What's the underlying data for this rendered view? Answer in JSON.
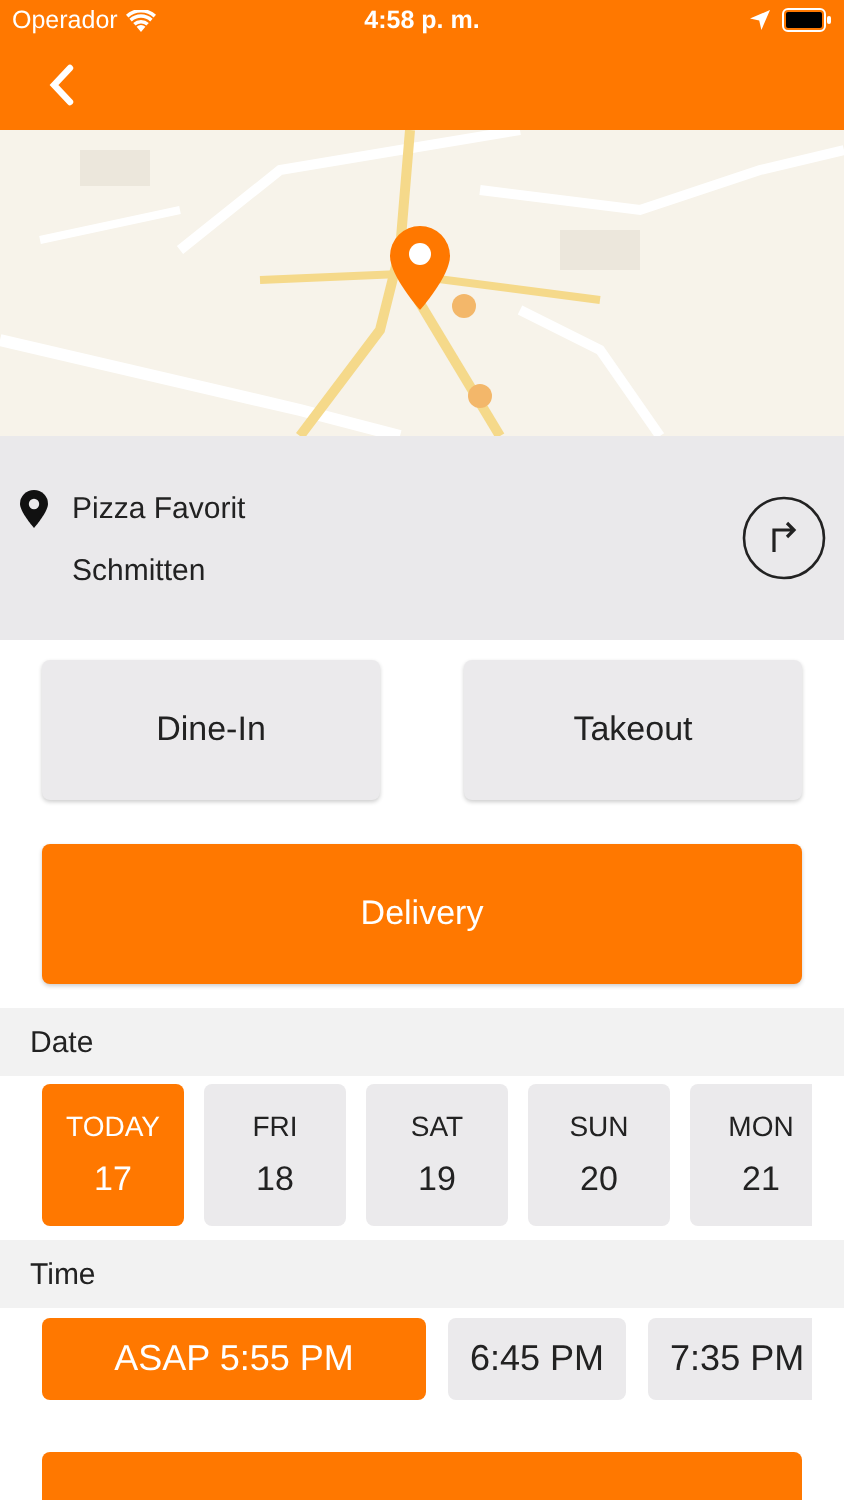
{
  "status_bar": {
    "carrier": "Operador",
    "time": "4:58 p. m."
  },
  "place": {
    "name": "Pizza Favorit",
    "city": "Schmitten"
  },
  "order_types": [
    {
      "label": "Dine-In",
      "selected": false
    },
    {
      "label": "Takeout",
      "selected": false
    },
    {
      "label": "Delivery",
      "selected": true
    }
  ],
  "date": {
    "header": "Date",
    "days": [
      {
        "weekday": "TODAY",
        "day": "17",
        "selected": true
      },
      {
        "weekday": "FRI",
        "day": "18",
        "selected": false
      },
      {
        "weekday": "SAT",
        "day": "19",
        "selected": false
      },
      {
        "weekday": "SUN",
        "day": "20",
        "selected": false
      },
      {
        "weekday": "MON",
        "day": "21",
        "selected": false
      }
    ]
  },
  "time": {
    "header": "Time",
    "slots": [
      {
        "label": "ASAP 5:55 PM",
        "selected": true
      },
      {
        "label": "6:45 PM",
        "selected": false
      },
      {
        "label": "7:35 PM",
        "selected": false
      }
    ]
  }
}
